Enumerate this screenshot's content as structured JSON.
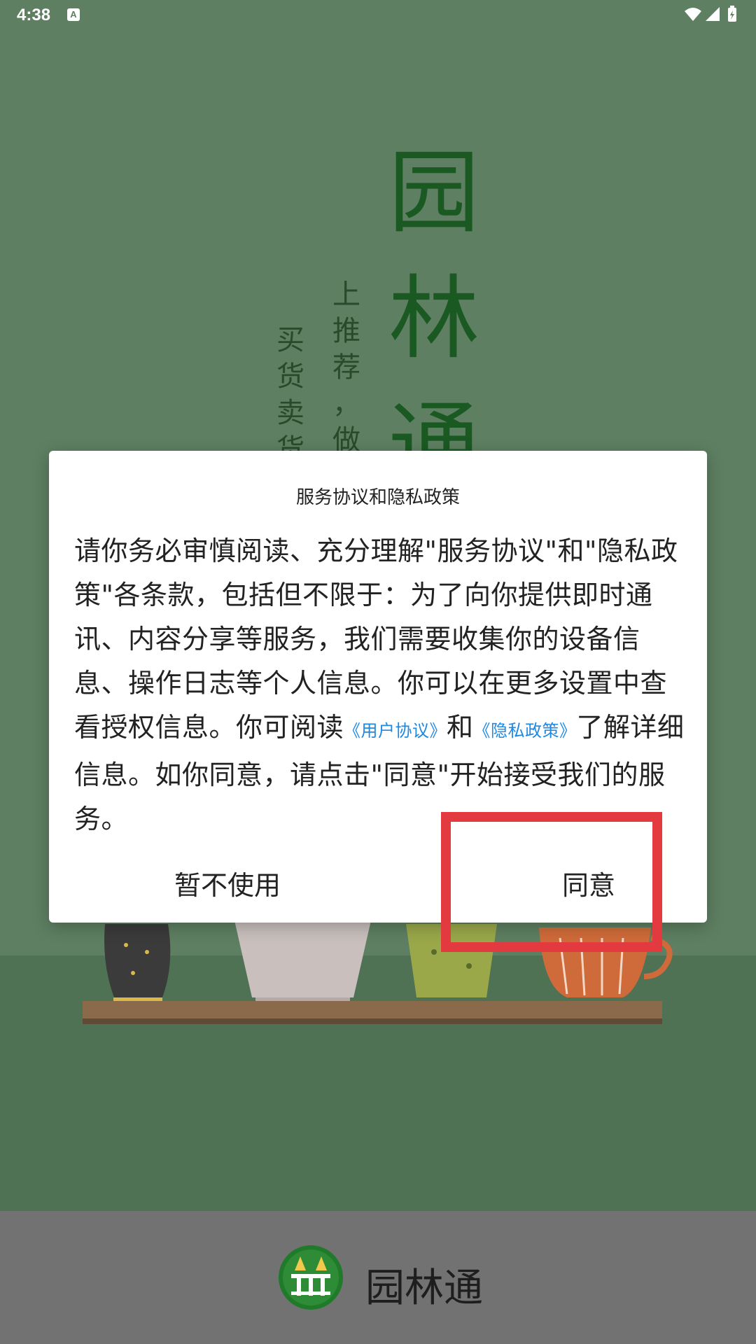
{
  "status_bar": {
    "time": "4:38",
    "notification_badge": "A"
  },
  "splash": {
    "big_title_chars": [
      "园",
      "林",
      "通"
    ],
    "slogan_right_chars": [
      "上",
      "推",
      "荐",
      "，",
      "做"
    ],
    "slogan_left_chars": [
      "买",
      "货",
      "卖",
      "货"
    ]
  },
  "dialog": {
    "title": "服务协议和隐私政策",
    "body_part1": "请你务必审慎阅读、充分理解\"服务协议\"和\"隐私政策\"各条款，包括但不限于：为了向你提供即时通讯、内容分享等服务，我们需要收集你的设备信息、操作日志等个人信息。你可以在更多设置中查看授权信息。你可阅读",
    "user_agreement_link": "《用户协议》",
    "body_and": "和",
    "privacy_policy_link": "《隐私政策》",
    "body_part2": "了解详细信息。如你同意，请点击\"同意\"开始接受我们的服务。",
    "decline_label": "暂不使用",
    "agree_label": "同意"
  },
  "footer": {
    "app_name": "园林通"
  },
  "colors": {
    "background": "#5e7f62",
    "title_green": "#1a5a22",
    "link_blue": "#1e88e5",
    "highlight_red": "#e23a3f",
    "footer_gray": "#727272"
  }
}
